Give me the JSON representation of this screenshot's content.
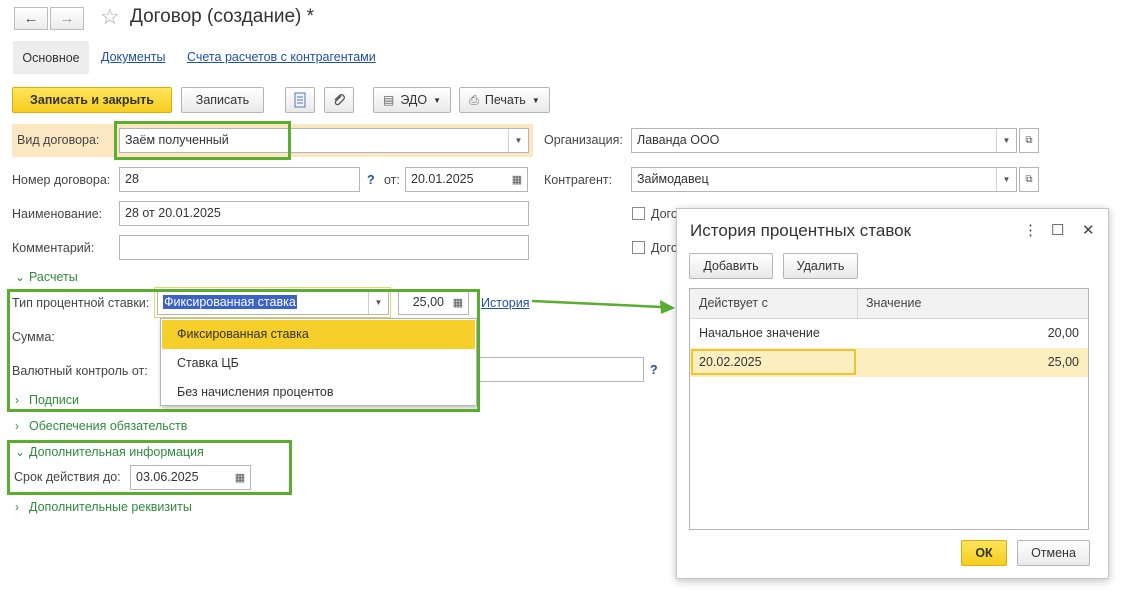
{
  "window": {
    "title": "Договор (создание) *",
    "back_icon": "←",
    "forward_icon": "→",
    "star_icon": "☆"
  },
  "tabs": {
    "main": "Основное",
    "documents": "Документы",
    "accounts": "Счета расчетов с контрагентами"
  },
  "toolbar": {
    "save_close": "Записать и закрыть",
    "save": "Записать",
    "edo": "ЭДО",
    "print": "Печать"
  },
  "form": {
    "contract_type_label": "Вид договора:",
    "contract_type_value": "Заём полученный",
    "number_label": "Номер договора:",
    "number_value": "28",
    "qmark": "?",
    "date_label": "от:",
    "date_value": "20.01.2025",
    "name_label": "Наименование:",
    "name_value": "28 от 20.01.2025",
    "comment_label": "Комментарий:",
    "comment_value": "",
    "organization_label": "Организация:",
    "organization_value": "Лаванда ООО",
    "counterparty_label": "Контрагент:",
    "counterparty_value": "Займодавец",
    "checkbox1_label": "Дого",
    "checkbox2_label": "Дого"
  },
  "calc_section": {
    "header": "Расчеты",
    "rate_type_label": "Тип процентной ставки:",
    "rate_type_value": "Фиксированная ставка",
    "rate_value": "25,00",
    "history_link": "История",
    "sum_label": "Сумма:",
    "currency_label": "Валютный контроль от:"
  },
  "dropdown": {
    "items": [
      "Фиксированная ставка",
      "Ставка ЦБ",
      "Без начисления процентов"
    ],
    "selected_index": 0
  },
  "sections": {
    "signatures": "Подписи",
    "collateral": "Обеспечения обязательств",
    "additional_info": "Дополнительная информация",
    "validity_label": "Срок действия до:",
    "validity_value": "03.06.2025",
    "additional_props": "Дополнительные реквизиты"
  },
  "dialog": {
    "title": "История процентных ставок",
    "add": "Добавить",
    "delete": "Удалить",
    "columns": [
      "Действует с",
      "Значение"
    ],
    "rows": [
      {
        "from": "Начальное значение",
        "value": "20,00"
      },
      {
        "from": "20.02.2025",
        "value": "25,00"
      }
    ],
    "ok": "ОК",
    "cancel": "Отмена"
  },
  "colors": {
    "accent_yellow": "#f7cf2a",
    "highlight_green": "#5aad2e",
    "section_green": "#2e8b3e",
    "link_blue": "#1f4fa8"
  }
}
